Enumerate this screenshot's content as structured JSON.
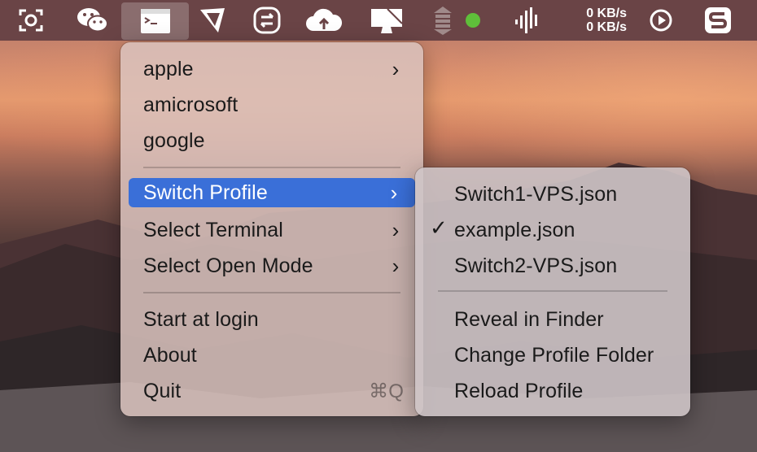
{
  "menubar": {
    "icons": [
      "screenshot-icon",
      "wechat-icon",
      "terminal-icon",
      "app-icon",
      "switch-icon",
      "cloud-icon",
      "display-icon",
      "stack-icon",
      "status-dot-icon",
      "audio-bars-icon",
      "play-icon",
      "s-app-icon"
    ],
    "net_up": "0 KB/s",
    "net_down": "0 KB/s"
  },
  "main_menu": {
    "items": [
      {
        "label": "apple",
        "has_submenu": true
      },
      {
        "label": "amicrosoft",
        "has_submenu": false
      },
      {
        "label": "google",
        "has_submenu": false
      },
      {
        "label": "Switch Profile",
        "has_submenu": true,
        "highlighted": true
      },
      {
        "label": "Select Terminal",
        "has_submenu": true
      },
      {
        "label": "Select Open Mode",
        "has_submenu": true
      },
      {
        "label": "Start at login"
      },
      {
        "label": "About"
      },
      {
        "label": "Quit",
        "shortcut": "⌘Q"
      }
    ]
  },
  "submenu": {
    "items": [
      {
        "label": "Switch1-VPS.json",
        "checked": false
      },
      {
        "label": "example.json",
        "checked": true
      },
      {
        "label": "Switch2-VPS.json",
        "checked": false
      },
      {
        "label": "Reveal in Finder"
      },
      {
        "label": "Change Profile Folder"
      },
      {
        "label": "Reload Profile"
      }
    ]
  },
  "colors": {
    "highlight": "#3a6fd8",
    "menubar": "#6a4446",
    "status_dot": "#5fbf3a"
  }
}
